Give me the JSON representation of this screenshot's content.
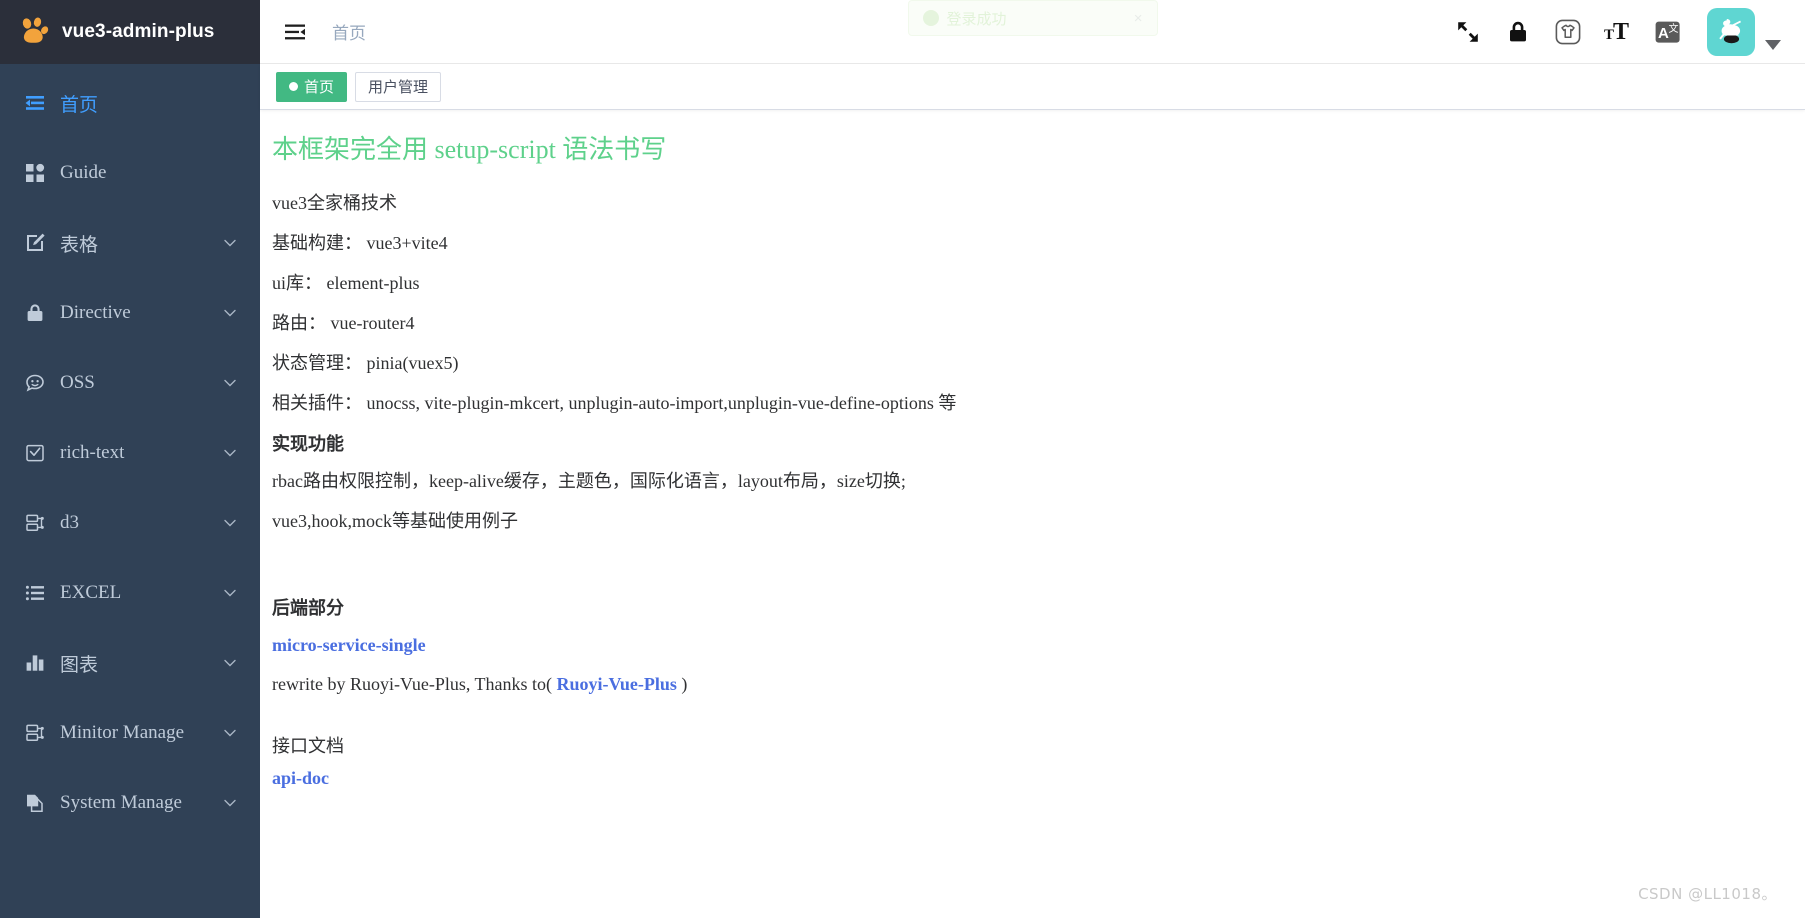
{
  "app": {
    "logo_title": "vue3-admin-plus",
    "logo_icon": "paw-print-icon"
  },
  "sidebar": {
    "items": [
      {
        "label": "首页",
        "icon": "home-list-icon",
        "has_arrow": false,
        "active": true
      },
      {
        "label": "Guide",
        "icon": "grid-squares-icon",
        "has_arrow": false,
        "active": false
      },
      {
        "label": "表格",
        "icon": "edit-square-icon",
        "has_arrow": true,
        "active": false
      },
      {
        "label": "Directive",
        "icon": "lock-icon",
        "has_arrow": true,
        "active": false
      },
      {
        "label": "OSS",
        "icon": "robot-face-icon",
        "has_arrow": true,
        "active": false
      },
      {
        "label": "rich-text",
        "icon": "check-square-icon",
        "has_arrow": true,
        "active": false
      },
      {
        "label": "d3",
        "icon": "tree-node-icon",
        "has_arrow": true,
        "active": false
      },
      {
        "label": "EXCEL",
        "icon": "bullet-list-icon",
        "has_arrow": true,
        "active": false
      },
      {
        "label": "图表",
        "icon": "bar-chart-icon",
        "has_arrow": true,
        "active": false
      },
      {
        "label": "Minitor Manage",
        "icon": "tree-node-icon",
        "has_arrow": true,
        "active": false
      },
      {
        "label": "System Manage",
        "icon": "documents-icon",
        "has_arrow": true,
        "active": false
      }
    ]
  },
  "navbar": {
    "hamburger_icon": "hamburger-collapse-icon",
    "breadcrumb": "首页",
    "icons": [
      {
        "name": "fullscreen-icon"
      },
      {
        "name": "lock-icon"
      },
      {
        "name": "theme-shirt-icon"
      },
      {
        "name": "font-size-icon"
      },
      {
        "name": "language-icon"
      }
    ],
    "avatar_icon": "user-avatar",
    "avatar_bg": "#5fd6d2",
    "caret_icon": "caret-down-icon"
  },
  "tags": [
    {
      "label": "首页",
      "active": true
    },
    {
      "label": "用户管理",
      "active": false
    }
  ],
  "toast": {
    "message": "登录成功",
    "close_label": "×",
    "icon": "success-check-icon"
  },
  "content": {
    "title": "本框架完全用 setup-script 语法书写",
    "lines": [
      "vue3全家桶技术",
      "基础构建： vue3+vite4",
      "ui库： element-plus",
      "路由： vue-router4",
      "状态管理： pinia(vuex5)",
      "相关插件： unocss, vite-plugin-mkcert, unplugin-auto-import,unplugin-vue-define-options 等"
    ],
    "features_heading": "实现功能",
    "features": [
      "rbac路由权限控制，keep-alive缓存，主题色，国际化语言，layout布局，size切换;",
      "vue3,hook,mock等基础使用例子"
    ],
    "backend_heading": "后端部分",
    "backend_link": "micro-service-single",
    "rewrite_prefix": "rewrite by Ruoyi-Vue-Plus, Thanks to( ",
    "rewrite_link": "Ruoyi-Vue-Plus",
    "rewrite_suffix": " )",
    "api_heading": "接口文档",
    "api_link": "api-doc"
  },
  "watermark": "CSDN @LL1018。",
  "colors": {
    "sidebar_bg": "#304156",
    "logo_bg": "#2b2f3a",
    "menu_text": "#bfcbd9",
    "menu_active": "#409eff",
    "tag_active_bg": "#42b983",
    "title_green": "#5ed18b",
    "link_blue": "#4a6ee0",
    "accent_orange": "#f2a33c"
  }
}
